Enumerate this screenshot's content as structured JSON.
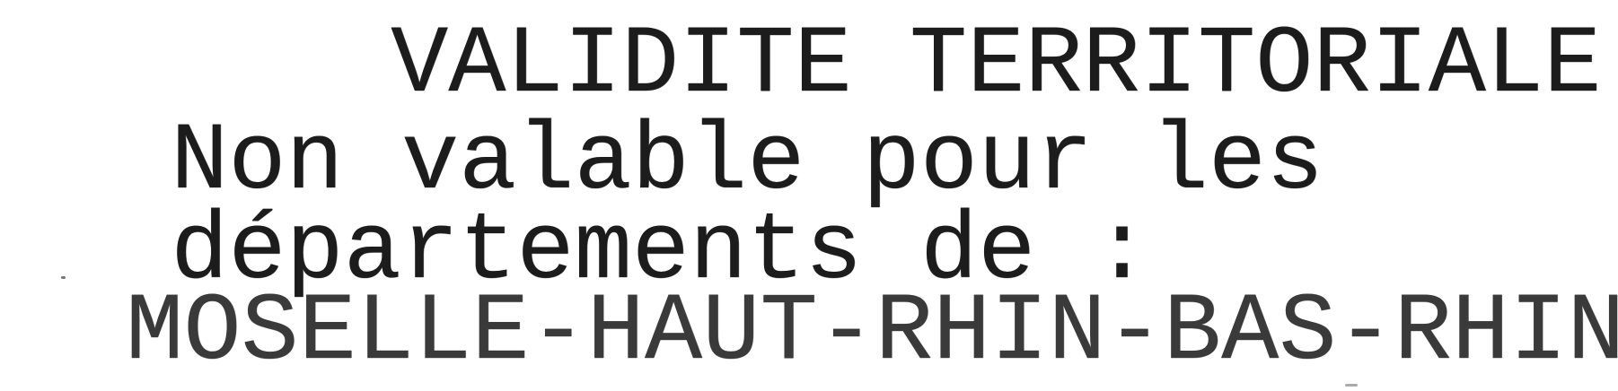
{
  "document": {
    "lines": [
      "VALIDITE TERRITORIALE",
      "Non valable pour les",
      "départements de :",
      "MOSELLE-HAUT-RHIN-BAS-RHIN"
    ]
  },
  "colors": {
    "ink": "#1c1c1c",
    "paper": "#ffffff"
  }
}
